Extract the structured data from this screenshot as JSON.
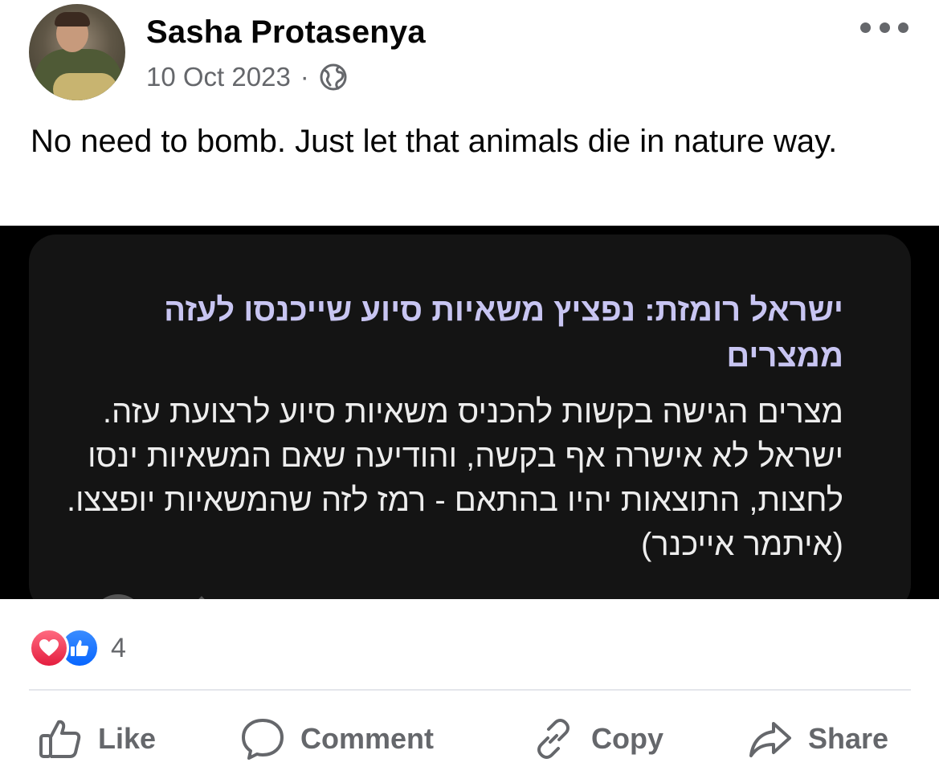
{
  "post": {
    "author": "Sasha Protasenya",
    "date": "10 Oct 2023",
    "separator": "·",
    "privacy_icon": "globe-icon",
    "text": "No need to bomb. Just let that animals die in nature way."
  },
  "media": {
    "headline": "ישראל רומזת: נפציץ משאיות סיוע שייכנסו לעזה ממצרים",
    "body": "מצרים הגישה בקשות להכניס משאיות סיוע לרצועת עזה. ישראל לא אישרה אף בקשה, והודיעה שאם המשאיות ינסו לחצות, התוצאות יהיו בהתאם - רמז לזה שהמשאיות יופצצו. (איתמר אייכנר)"
  },
  "reactions": {
    "icons": [
      "love-icon",
      "like-icon"
    ],
    "count": "4"
  },
  "actions": {
    "like": "Like",
    "comment": "Comment",
    "copy": "Copy",
    "share": "Share"
  },
  "colors": {
    "text_primary": "#050505",
    "text_secondary": "#65676b",
    "love": "#e41e3f",
    "like": "#0866ff",
    "headline": "#c8c5f2"
  }
}
